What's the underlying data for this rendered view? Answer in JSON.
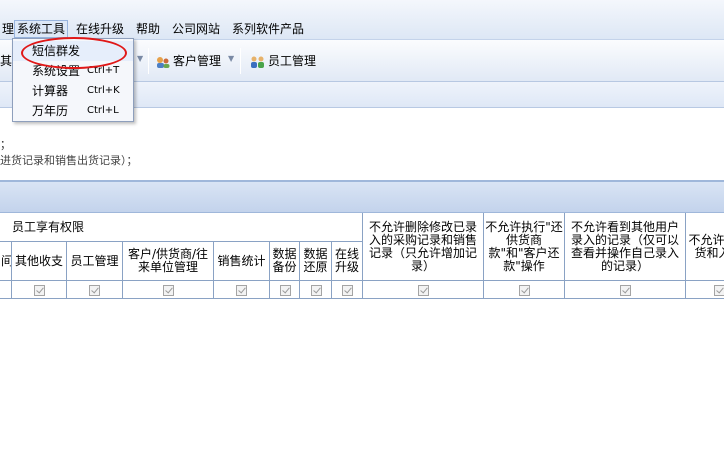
{
  "menubar": {
    "items": [
      {
        "label": "理"
      },
      {
        "label": "系统工具"
      },
      {
        "label": "在线升级"
      },
      {
        "label": "帮助"
      },
      {
        "label": "公司网站"
      },
      {
        "label": "系列软件产品"
      }
    ]
  },
  "toolbar": {
    "partial_label": "其",
    "customer_btn": "客户管理",
    "staff_btn": "员工管理"
  },
  "dropdown": {
    "items": [
      {
        "label": "短信群发",
        "shortcut": ""
      },
      {
        "label": "系统设置",
        "shortcut": "Ctrl+T"
      },
      {
        "label": "计算器",
        "shortcut": "Ctrl+K"
      },
      {
        "label": "万年历",
        "shortcut": "Ctrl+L"
      }
    ]
  },
  "notes": {
    "line1": "；",
    "line2": "进货记录和销售出货记录）；"
  },
  "table": {
    "group_header": "员工享有权限",
    "columns": [
      {
        "label": "间"
      },
      {
        "label": "其他收支"
      },
      {
        "label": "员工管理"
      },
      {
        "label": "客户/供货商/往来单位管理"
      },
      {
        "label": "销售统计"
      },
      {
        "label": "数据备份"
      },
      {
        "label": "数据还原"
      },
      {
        "label": "在线升级"
      }
    ],
    "restrictions": [
      {
        "label": "不允许删除修改已录入的采购记录和销售记录（只允许增加记录）"
      },
      {
        "label": "不允许执行\"还供货商款\"和\"客户还款\"操作"
      },
      {
        "label": "不允许看到其他用户录入的记录（仅可以查看并操作自己录入的记录）"
      },
      {
        "label": "不允许进货和入"
      }
    ]
  }
}
